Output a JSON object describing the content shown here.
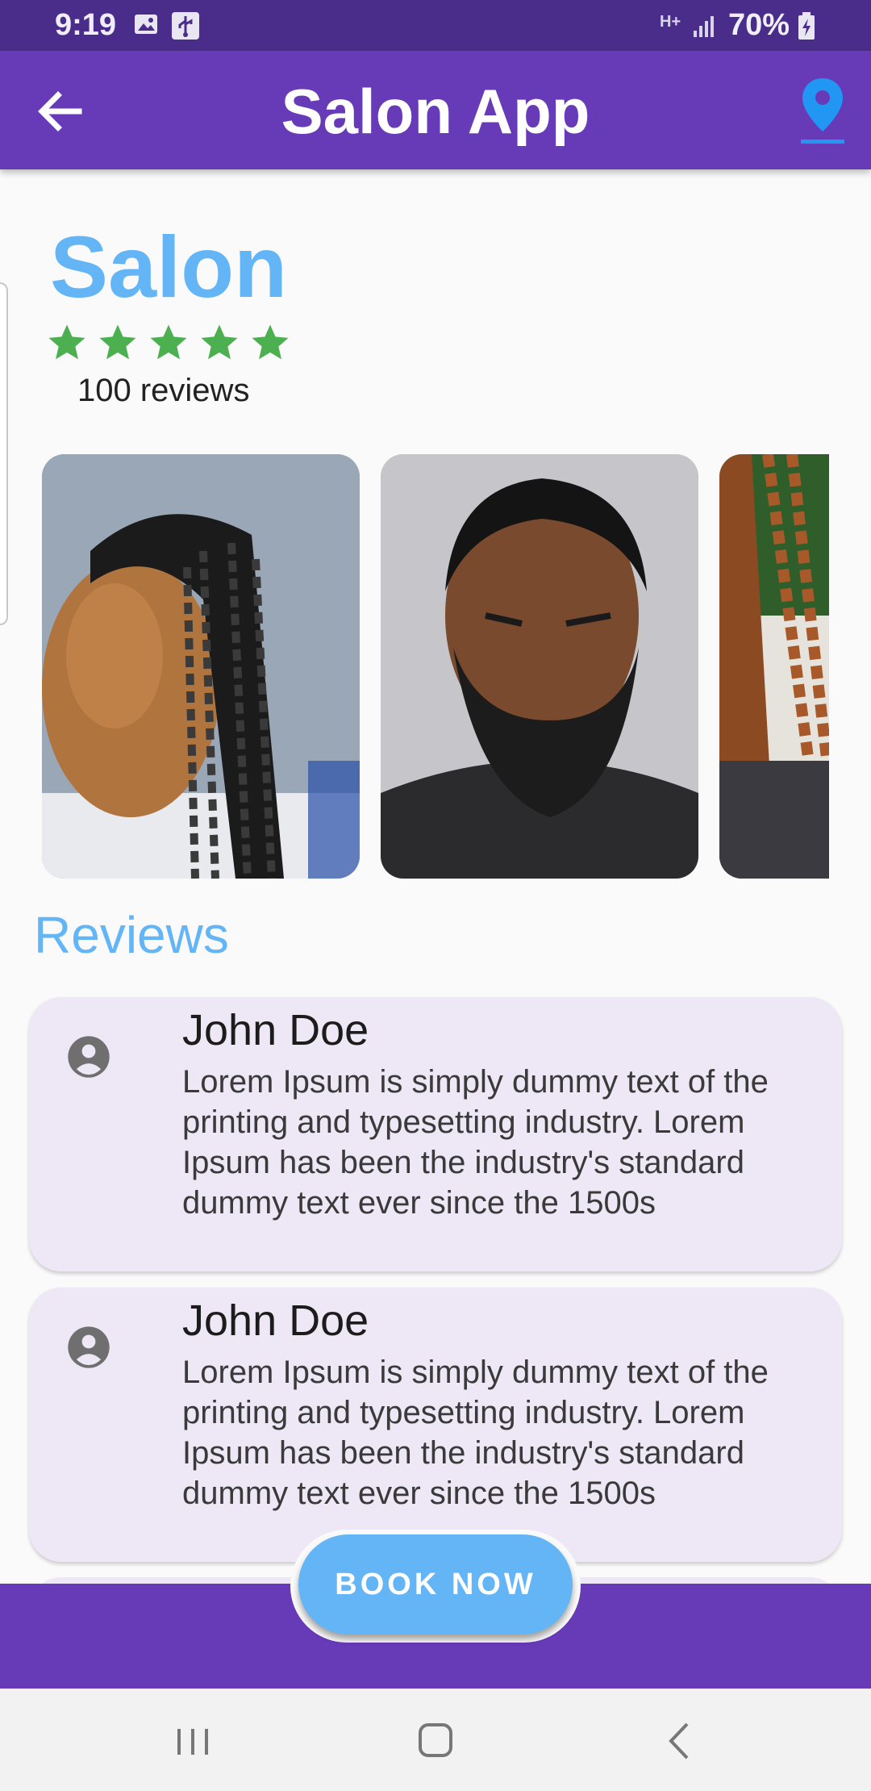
{
  "status_bar": {
    "time": "9:19",
    "network": "H+",
    "battery": "70%"
  },
  "app_bar": {
    "title": "Salon App",
    "icons": [
      "arrow-back-icon",
      "location-pin-icon"
    ]
  },
  "salon": {
    "name": "Salon",
    "rating_stars": 5,
    "reviews_count": "100 reviews"
  },
  "gallery": {
    "photos": [
      "braided-hairstyle-photo",
      "beard-fade-haircut-photo",
      "copper-braids-photo"
    ]
  },
  "reviews": {
    "heading": "Reviews",
    "items": [
      {
        "name": "John Doe",
        "text": "Lorem Ipsum is simply dummy text of the printing and typesetting industry. Lorem Ipsum has been the industry's standard dummy text ever since the 1500s"
      },
      {
        "name": "John Doe",
        "text": "Lorem Ipsum is simply dummy text of the printing and typesetting industry. Lorem Ipsum has been the industry's standard dummy text ever since the 1500s"
      }
    ]
  },
  "actions": {
    "book_now": "BOOK NOW"
  },
  "colors": {
    "status_bar": "#4a2d8a",
    "app_bar": "#673ab7",
    "accent": "#64b5f6",
    "star": "#4caf50",
    "review_card": "#ede7f6",
    "location_icon": "#2196f3"
  }
}
